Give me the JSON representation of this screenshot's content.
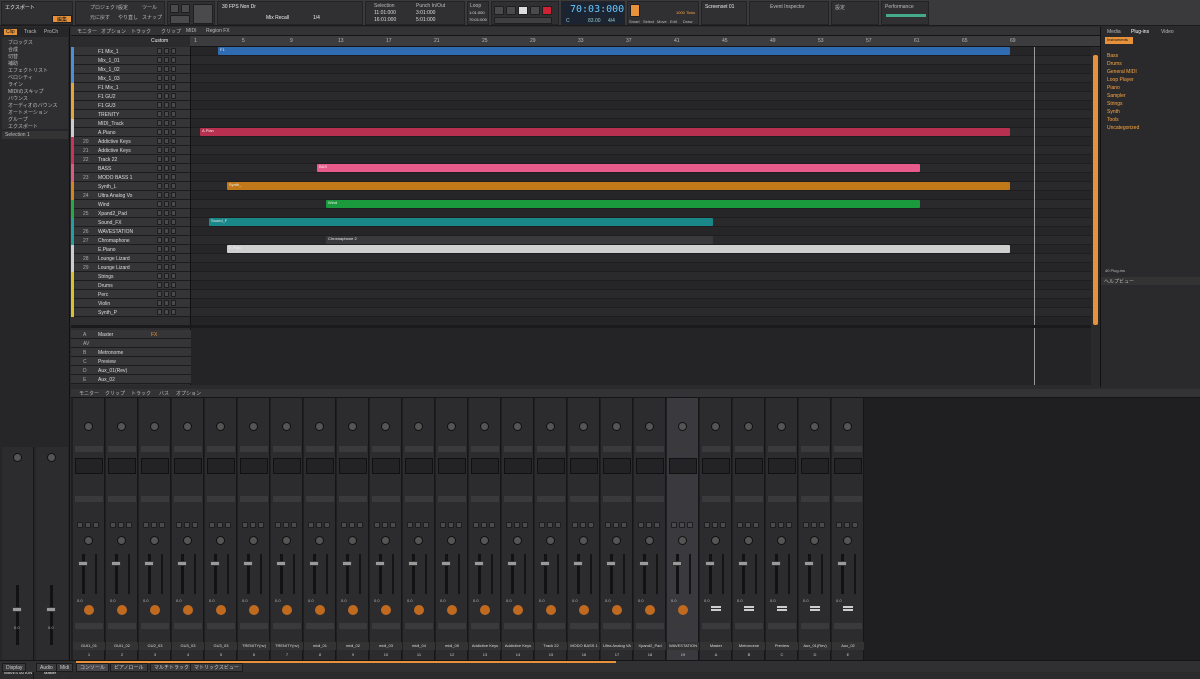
{
  "controlbar": {
    "project_label": "エクスポート",
    "save_label": "保存",
    "edit_label": "編集",
    "menu_items": [
      "プロジェクト",
      "設定"
    ],
    "undo_items": [
      "元に戻す",
      "やり直し"
    ],
    "tools_label": "ツール",
    "snap_label": "スナップ",
    "fps": "30 FPS Non Dr",
    "snap_mode": "Mix Recall",
    "grid": "1/4",
    "selection_label": "Selection",
    "selection_start": "11:01:000",
    "selection_end": "16:01:000",
    "punch_label": "Punch In/Out",
    "punch_start": "3:01:000",
    "punch_end": "5:01:000",
    "loop_label": "Loop",
    "loop_start": "1:01:000",
    "loop_end": "70:01:000",
    "time": "70:03:000",
    "tempo": "83.00",
    "meter": "4/4",
    "key": "C",
    "screenset": "Screenset 01",
    "event_inspector": "Event Inspector",
    "performance": "Performance",
    "modes": [
      "Smart",
      "Select",
      "Move",
      "Edit",
      "Draw"
    ],
    "tick_value": "1000 Ticks"
  },
  "inspector": {
    "tabs": [
      "Clip",
      "Track",
      "ProCh"
    ],
    "items": [
      "ブロックス",
      "合成",
      "切替",
      "補助",
      "エフェクトリスト",
      "ベロシティ",
      "ライン",
      "MIDIのスキップ",
      "バウンス",
      "オーディオのバウンス",
      "オートメーション",
      "グループ",
      "エクスポート"
    ],
    "group": "Selection 1"
  },
  "sbar": {
    "items": [
      "モニター",
      "オプション",
      "トラック",
      "クリップ",
      "MIDI",
      "Region FX"
    ],
    "group": "Custom"
  },
  "ruler": {
    "ticks": [
      "1",
      "5",
      "9",
      "13",
      "17",
      "21",
      "25",
      "29",
      "33",
      "37",
      "41",
      "45",
      "49",
      "53",
      "57",
      "61",
      "65",
      "69"
    ]
  },
  "tracks": [
    {
      "no": "",
      "name": "F1 Mix_1",
      "color": "#4a8fd8"
    },
    {
      "no": "",
      "name": "Mix_1_01",
      "color": "#4a8fd8"
    },
    {
      "no": "",
      "name": "Mix_1_02",
      "color": "#4a8fd8"
    },
    {
      "no": "",
      "name": "Mix_1_03",
      "color": "#4a8fd8"
    },
    {
      "no": "",
      "name": "F1 Mix_1",
      "color": "#e7a535"
    },
    {
      "no": "",
      "name": "F1 GU2",
      "color": "#e7a535"
    },
    {
      "no": "",
      "name": "F1 GU3",
      "color": "#e7a535"
    },
    {
      "no": "",
      "name": "TRENITY",
      "color": "#e7a535"
    },
    {
      "no": "",
      "name": "MIDI_Track",
      "color": "#cccccc"
    },
    {
      "no": "",
      "name": "A.Piano",
      "color": "#cccccc"
    },
    {
      "no": "20",
      "name": "Addictive Keys",
      "color": "#cc3355"
    },
    {
      "no": "21",
      "name": "Addictive Keys",
      "color": "#cc3355"
    },
    {
      "no": "22",
      "name": "Track 22",
      "color": "#cc3355"
    },
    {
      "no": "",
      "name": "BASS",
      "color": "#e05a80"
    },
    {
      "no": "23",
      "name": "MODO BASS 1",
      "color": "#e05a80"
    },
    {
      "no": "",
      "name": "Synth_L",
      "color": "#d4861a"
    },
    {
      "no": "24",
      "name": "Ultra Analog Vo",
      "color": "#d4861a"
    },
    {
      "no": "",
      "name": "Wind",
      "color": "#22aa44"
    },
    {
      "no": "25",
      "name": "Xpand2_Pad",
      "color": "#22aa44"
    },
    {
      "no": "",
      "name": "Sound_FX",
      "color": "#22a0a0"
    },
    {
      "no": "26",
      "name": "WAVESTATION",
      "color": "#22a0a0"
    },
    {
      "no": "27",
      "name": "Chromaphone",
      "color": "#22a0a0"
    },
    {
      "no": "",
      "name": "E.Piano",
      "color": "#cccccc"
    },
    {
      "no": "28",
      "name": "Lounge Lizard",
      "color": "#cccccc"
    },
    {
      "no": "29",
      "name": "Lounge Lizard",
      "color": "#cccccc"
    },
    {
      "no": "",
      "name": "Strings",
      "color": "#d8c030"
    },
    {
      "no": "",
      "name": "Drums",
      "color": "#d8c030"
    },
    {
      "no": "",
      "name": "Perc",
      "color": "#d8c030"
    },
    {
      "no": "",
      "name": "Violin",
      "color": "#d8c030"
    },
    {
      "no": "",
      "name": "Synth_P",
      "color": "#d8c030"
    }
  ],
  "clips": [
    {
      "name": "F1",
      "row": 0,
      "start": 0.03,
      "end": 0.91,
      "color": "#2e6bb0"
    },
    {
      "name": "A.Pian",
      "row": 9,
      "start": 0.01,
      "end": 0.91,
      "color": "#b83050"
    },
    {
      "name": "BAS",
      "row": 13,
      "start": 0.14,
      "end": 0.81,
      "color": "#e85a8a"
    },
    {
      "name": "Synth_",
      "row": 15,
      "start": 0.04,
      "end": 0.91,
      "color": "#c07818"
    },
    {
      "name": "Wind",
      "row": 17,
      "start": 0.15,
      "end": 0.81,
      "color": "#1a9a3c"
    },
    {
      "name": "Sound_F",
      "row": 19,
      "start": 0.02,
      "end": 0.58,
      "color": "#1a8888"
    },
    {
      "name": "E.Pian",
      "row": 22,
      "start": 0.04,
      "end": 0.91,
      "color": "#cfcfcf"
    },
    {
      "name": "Chromaphone 2",
      "row": 21,
      "start": 0.15,
      "end": 0.58,
      "color": "#3a3a3c"
    }
  ],
  "buses": [
    {
      "key": "A",
      "name": "Master",
      "fx": "FX"
    },
    {
      "key": "AV",
      "name": "",
      "fx": ""
    },
    {
      "key": "B",
      "name": "Metronome",
      "fx": ""
    },
    {
      "key": "C",
      "name": "Preview",
      "fx": ""
    },
    {
      "key": "D",
      "name": "Aux_01(Rev)",
      "fx": ""
    },
    {
      "key": "E",
      "name": "Aux_02",
      "fx": ""
    }
  ],
  "browser": {
    "tabs": [
      "Media",
      "Plug-ins",
      "Video"
    ],
    "filter": "Instruments",
    "folders": [
      "Bass",
      "Drums",
      "General MIDI",
      "Loop Player",
      "Piano",
      "Sampler",
      "Strings",
      "Synth",
      "Tools",
      "Uncategorized"
    ],
    "count": "40 Plug-ins",
    "help": "ヘルプビュー"
  },
  "consoletb": {
    "items": [
      "モニター",
      "クリップ",
      "トラック",
      "バス",
      "オプション"
    ]
  },
  "strips": [
    {
      "name": "GUI1_01",
      "num": "1",
      "val": "0.0"
    },
    {
      "name": "GUI1_02",
      "num": "2",
      "val": "0.0"
    },
    {
      "name": "GU2_03",
      "num": "3",
      "val": "0.0"
    },
    {
      "name": "GU3_03",
      "num": "4",
      "val": "0.0"
    },
    {
      "name": "GU3_03",
      "num": "5",
      "val": "0.0"
    },
    {
      "name": "TRENITY(nv)",
      "num": "6",
      "val": "0.0"
    },
    {
      "name": "TRENITY(nv)",
      "num": "7",
      "val": "0.0"
    },
    {
      "name": "midi_01",
      "num": "8",
      "val": "0.0"
    },
    {
      "name": "midi_02",
      "num": "9",
      "val": "0.0"
    },
    {
      "name": "midi_03",
      "num": "10",
      "val": "0.0"
    },
    {
      "name": "midi_04",
      "num": "11",
      "val": "0.0"
    },
    {
      "name": "midi_05",
      "num": "12",
      "val": "0.0"
    },
    {
      "name": "Addictive Keys",
      "num": "13",
      "val": "0.0"
    },
    {
      "name": "Addictive Keys",
      "num": "14",
      "val": "0.0"
    },
    {
      "name": "Track 22",
      "num": "15",
      "val": "0.0"
    },
    {
      "name": "MODO BASS 1",
      "num": "16",
      "val": "0.0"
    },
    {
      "name": "Ultra Analog VA",
      "num": "17",
      "val": "0.0"
    },
    {
      "name": "Xpand2_Pad",
      "num": "18",
      "val": "0.0"
    },
    {
      "name": "WAVESTATION",
      "num": "19",
      "val": "0.0"
    },
    {
      "name": "Master",
      "num": "A",
      "val": "0.0"
    },
    {
      "name": "Metronome",
      "num": "B",
      "val": "0.0"
    },
    {
      "name": "Preview",
      "num": "C",
      "val": "0.0"
    },
    {
      "name": "Aux_01(Rev)",
      "num": "D",
      "val": "0.0"
    },
    {
      "name": "Aux_02",
      "num": "E",
      "val": "0.0"
    }
  ],
  "inspector_strips": [
    {
      "name": "WAVESTATION",
      "val": "0.0"
    },
    {
      "name": "Master",
      "val": "0.0"
    }
  ],
  "bottom": {
    "tabs": [
      "Display",
      "Audio",
      "Midi"
    ],
    "views": [
      "コンソール",
      "ピアノロール",
      "マルチトラック",
      "マトリックスビュー"
    ]
  }
}
